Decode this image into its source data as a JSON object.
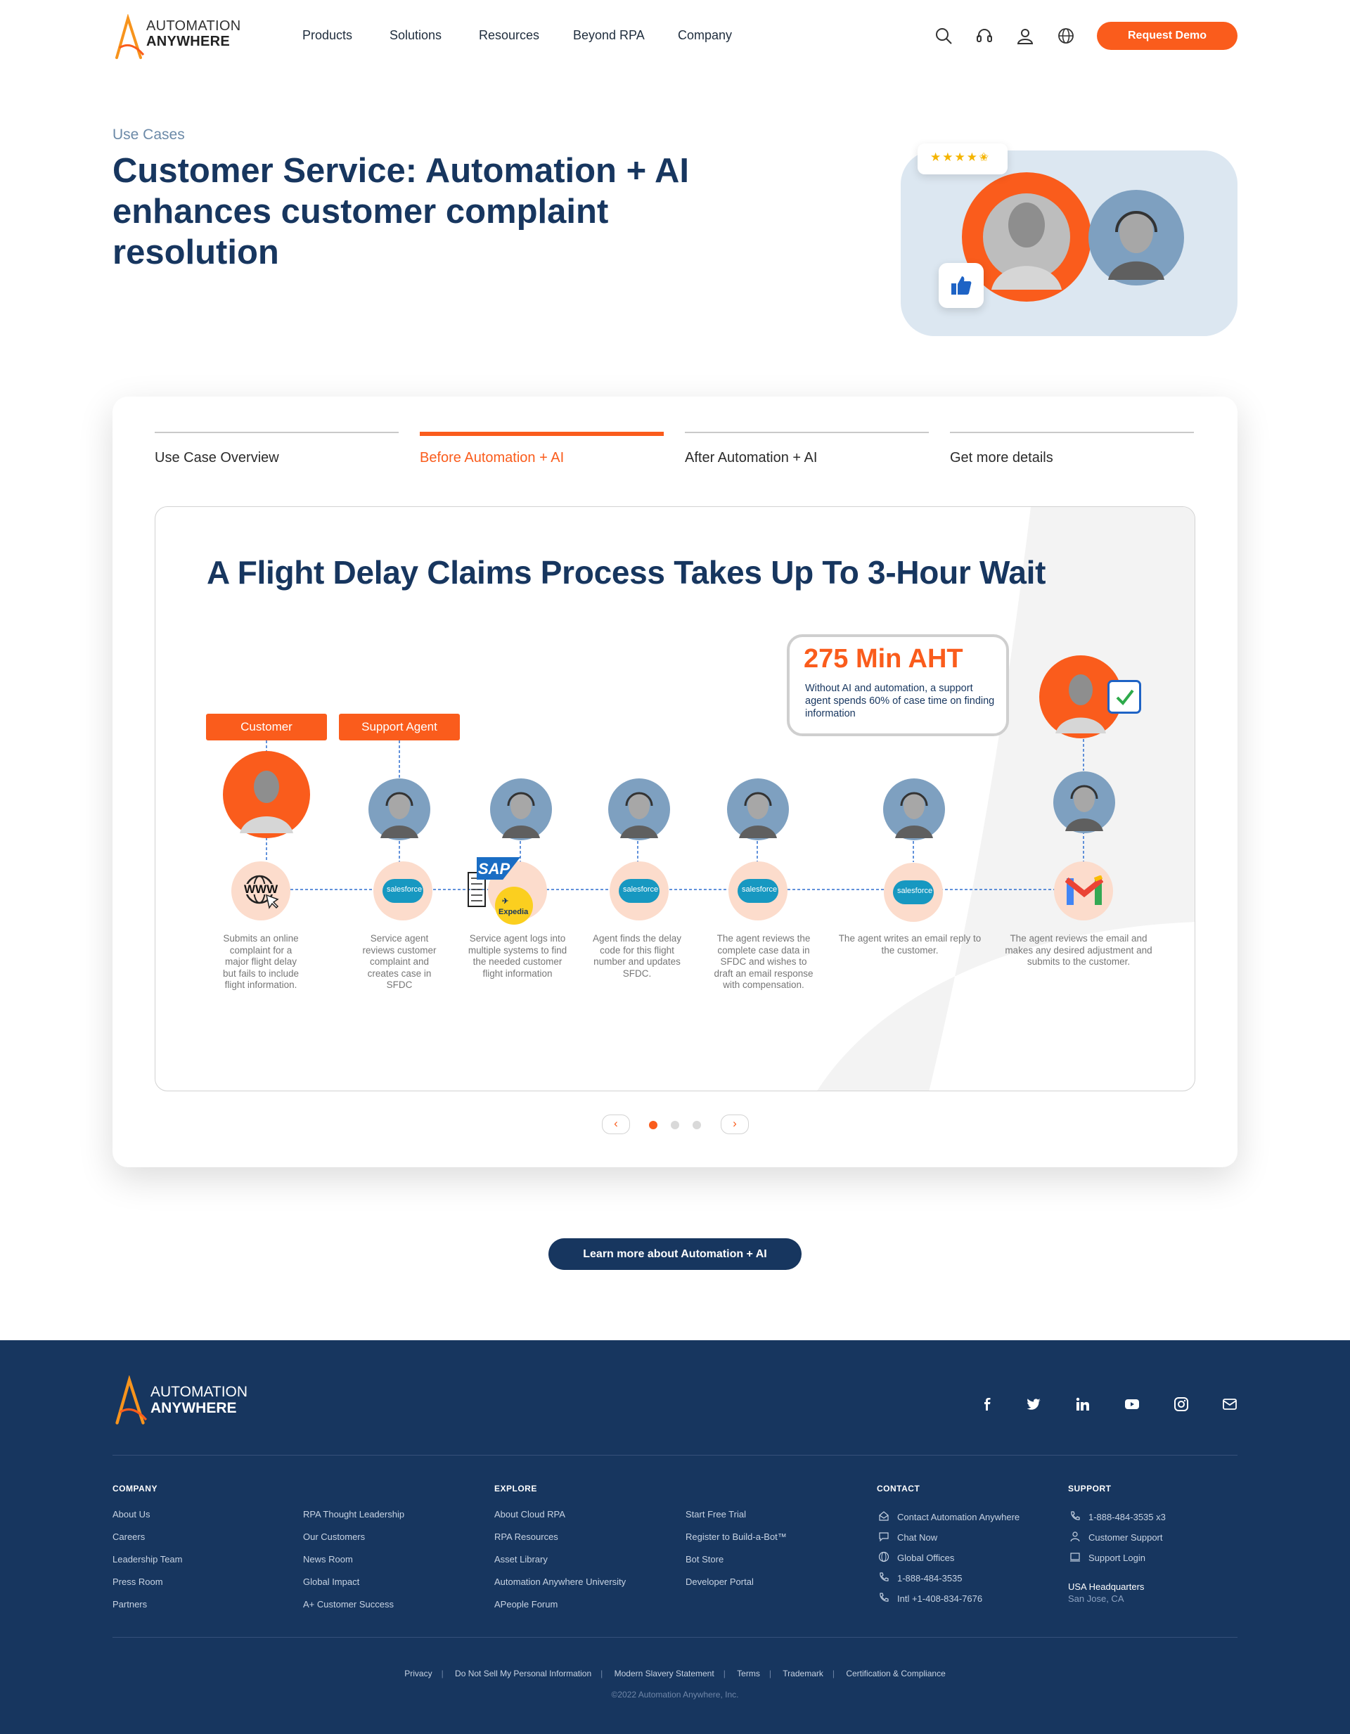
{
  "header": {
    "logo_line1": "AUTOMATION",
    "logo_line2": "ANYWHERE",
    "nav": [
      "Products",
      "Solutions",
      "Resources",
      "Beyond RPA",
      "Company"
    ],
    "icons": [
      "search-icon",
      "headset-icon",
      "user-icon",
      "globe-icon"
    ],
    "cta_label": "Request Demo",
    "brand_color": "#fa5c1c",
    "navy_color": "#17365f"
  },
  "hero": {
    "eyebrow": "Use Cases",
    "title": "Customer Service: Automation + AI enhances customer complaint resolution",
    "rating_stars": 4.5
  },
  "tabs": [
    {
      "label": "Use Case Overview",
      "active": false
    },
    {
      "label": "Before Automation + AI",
      "active": true
    },
    {
      "label": "After Automation + AI",
      "active": false
    },
    {
      "label": "Get more details",
      "active": false
    }
  ],
  "slide": {
    "title": "A Flight Delay Claims Process Takes Up To 3-Hour Wait",
    "aht_value": "275 Min AHT",
    "aht_desc": "Without AI and automation, a support agent spends 60% of case time on finding information",
    "tag_customer": "Customer",
    "tag_agent": "Support Agent",
    "system_labels": {
      "www": "WWW",
      "salesforce": "salesforce",
      "sap": "SAP",
      "expedia": "Expedia"
    },
    "steps": [
      "Submits an online complaint for a major flight delay but fails to include flight information.",
      "Service agent reviews customer complaint and creates case in SFDC",
      "Service agent logs into multiple systems to find the needed customer flight information",
      "Agent finds the delay code for this flight number and updates SFDC.",
      "The agent reviews the complete case data in SFDC and wishes to draft an email response with compensation.",
      "The agent writes an email reply to the customer.",
      "The agent reviews the email and makes any desired adjustment and submits to the customer."
    ],
    "pagination": {
      "current": 1,
      "total": 3,
      "prev": "‹",
      "next": "›"
    }
  },
  "learn_more": "Learn more about Automation + AI",
  "footer": {
    "logo_line1": "AUTOMATION",
    "logo_line2": "ANYWHERE",
    "social": [
      "facebook-icon",
      "twitter-icon",
      "linkedin-icon",
      "youtube-icon",
      "instagram-icon",
      "mail-icon"
    ],
    "company_heading": "COMPANY",
    "company_col1": [
      "About Us",
      "Careers",
      "Leadership Team",
      "Press Room",
      "Partners"
    ],
    "company_col2": [
      "RPA Thought Leadership",
      "Our Customers",
      "News Room",
      "Global Impact",
      "A+ Customer Success"
    ],
    "explore_heading": "EXPLORE",
    "explore_col1": [
      "About Cloud RPA",
      "RPA Resources",
      "Asset Library",
      "Automation Anywhere University",
      "APeople Forum"
    ],
    "explore_col2": [
      "Start Free Trial",
      "Register to Build-a-Bot™",
      "Bot Store",
      "Developer Portal"
    ],
    "contact_heading": "CONTACT",
    "contact": [
      "Contact Automation Anywhere",
      "Chat Now",
      "Global Offices",
      "1-888-484-3535",
      "Intl +1-408-834-7676"
    ],
    "support_heading": "SUPPORT",
    "support": [
      "1-888-484-3535 x3",
      "Customer Support",
      "Support Login"
    ],
    "hq_label": "USA Headquarters",
    "hq_city": "San Jose, CA",
    "bottom_links": [
      "Privacy",
      "Do Not Sell My Personal Information",
      "Modern Slavery Statement",
      "Terms",
      "Trademark",
      "Certification & Compliance"
    ],
    "copyright": "©2022 Automation Anywhere, Inc."
  }
}
